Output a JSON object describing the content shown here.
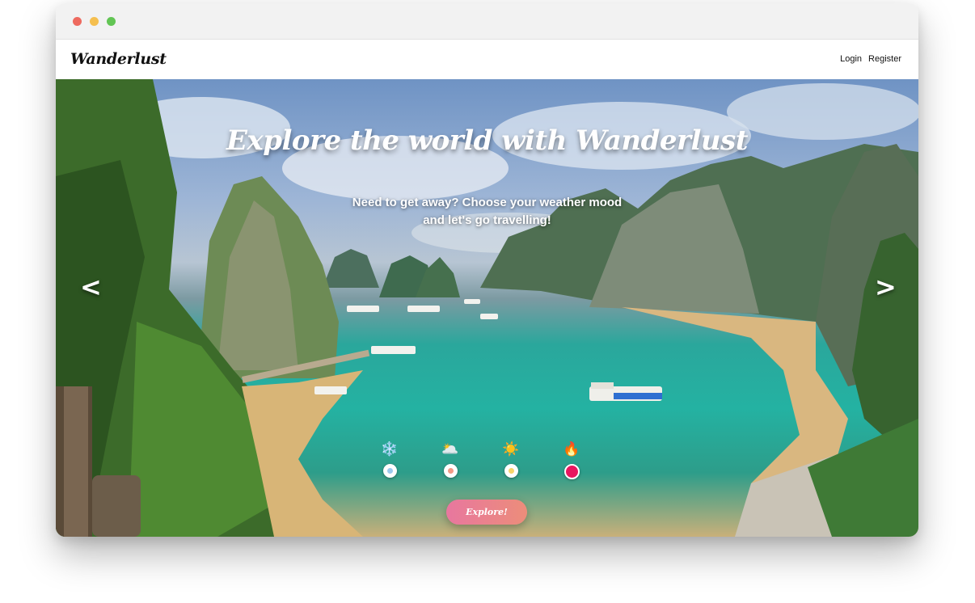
{
  "window": {
    "controls": [
      "close",
      "minimize",
      "maximize"
    ]
  },
  "navbar": {
    "brand": "Wanderlust",
    "links": [
      {
        "label": "Login"
      },
      {
        "label": "Register"
      }
    ]
  },
  "hero": {
    "title": "Explore the world with Wanderlust",
    "subtitle": "Need to get away? Choose your weather mood and let's go travelling!",
    "prev_arrow": "<",
    "next_arrow": ">",
    "moods": [
      {
        "icon": "snowflake-icon",
        "glyph": "❄️",
        "dot_color": "#9cc9ee",
        "selected": false
      },
      {
        "icon": "cloud-sun-icon",
        "glyph": "🌥️",
        "dot_color": "#f29a86",
        "selected": false
      },
      {
        "icon": "sun-icon",
        "glyph": "☀️",
        "dot_color": "#f7d56a",
        "selected": false
      },
      {
        "icon": "fire-icon",
        "glyph": "🔥",
        "dot_color": "#e8165f",
        "selected": true
      }
    ],
    "explore_label": "Explore!"
  },
  "colors": {
    "accent_pink": "#e8779f",
    "accent_coral": "#ec8d7a",
    "selected": "#e8165f"
  }
}
